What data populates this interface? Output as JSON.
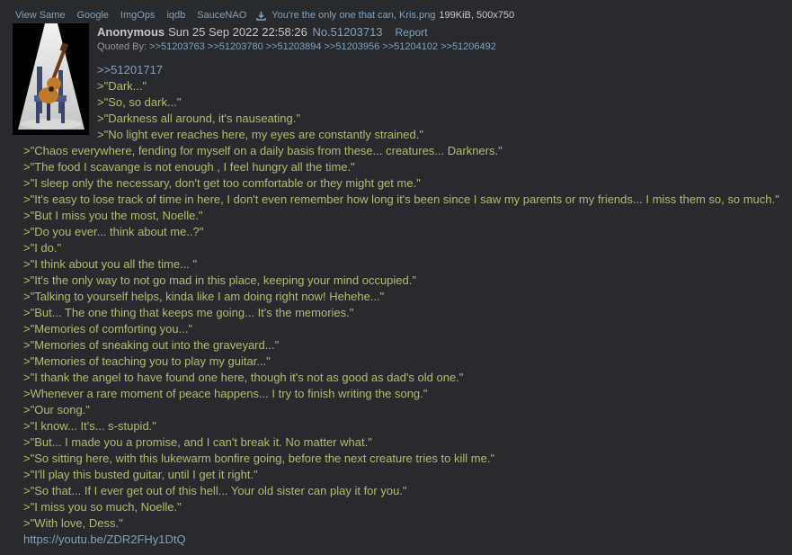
{
  "file_bar": {
    "links": [
      "View Same",
      "Google",
      "ImgOps",
      "iqdb",
      "SauceNAO"
    ],
    "filename": "You're the only one that can, Kris.png",
    "fileinfo": "199KiB, 500x750"
  },
  "post": {
    "name": "Anonymous",
    "datetime": "Sun 25 Sep 2022 22:58:26",
    "number": "No.51203713",
    "report": "Report",
    "quoted_by_label": "Quoted By:",
    "quoted_by": [
      ">>51203763",
      ">>51203780",
      ">>51203894",
      ">>51203956",
      ">>51204102",
      ">>51206492"
    ],
    "quote_link": ">>51201717",
    "lines_beside_image": [
      ">\"Dark...\"",
      ">\"So, so dark...\"",
      ">\"Darkness all around, it's nauseating.\"",
      ">\"No light ever reaches here, my eyes are constantly strained.\""
    ],
    "lines_full": [
      ">\"Chaos everywhere, fending for myself on a daily basis from these... creatures... Darkners.\"",
      ">\"The food I scavange is not enough , I feel hungry all the time.\"",
      ">\"I sleep only the necessary, don't get too comfortable or they might get me.\"",
      ">\"It's easy to lose track of time in here, I don't even remember how long it's been since I saw my parents or my friends... I miss them so, so much.\"",
      ">\"But I miss you the most, Noelle.\"",
      ">\"Do you ever... think about me..?\"",
      ">\"I do.\"",
      ">\"I think about you all the time... \"",
      ">\"It's the only way to not go mad in this place, keeping your mind occupied.\"",
      ">\"Talking to yourself helps, kinda like I am doing right now! Hehehe...\"",
      ">\"But... The one thing that keeps me going... It's the memories.\"",
      ">\"Memories of comforting you...\"",
      ">\"Memories of sneaking out into the graveyard...\"",
      ">\"Memories of teaching you to play my guitar...\"",
      ">\"I thank the angel to have found one here, though it's not as good as dad's old one.\"",
      ">Whenever a rare moment of peace happens... I try to finish writing the song.\"",
      ">\"Our song.\"",
      ">\"I know... It's... s-stupid.\"",
      ">\"But... I made you a promise, and I can't break it. No matter what.\"",
      ">\"So sitting here, with this lukewarm bonfire going, before the next creature tries to kill me.\"",
      ">\"I'll play this busted guitar, until I get it right.\"",
      ">\"So that... If I ever get out of this hell... Your old sister can play it for you.\"",
      ">\"I miss you so much, Noelle.\"",
      ">\"With love, Dess.\""
    ],
    "link": "https://youtu.be/ZDR2FHy1DtQ"
  },
  "colors": {
    "background": "#282a2e",
    "greentext": "#b5bd68",
    "link": "#81a2be",
    "text": "#c5c8c6"
  },
  "icons": {
    "download": "download-icon",
    "thumbnail": "guitar-on-chair-thumbnail"
  }
}
